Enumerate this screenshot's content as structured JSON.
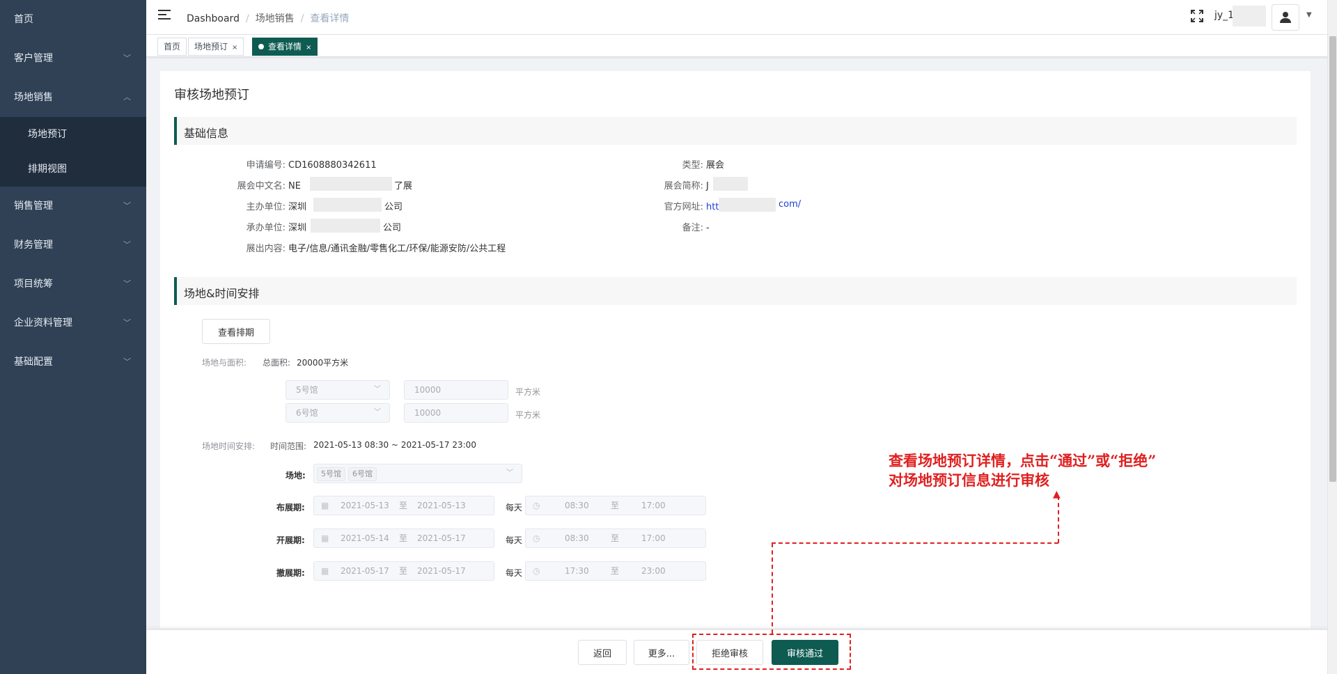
{
  "sidebar": {
    "items": [
      {
        "label": "首页"
      },
      {
        "label": "客户管理",
        "chevron": "down"
      },
      {
        "label": "场地销售",
        "chevron": "up",
        "children": [
          {
            "label": "场地预订"
          },
          {
            "label": "排期视图"
          }
        ]
      },
      {
        "label": "销售管理",
        "chevron": "down"
      },
      {
        "label": "财务管理",
        "chevron": "down"
      },
      {
        "label": "项目统筹",
        "chevron": "down"
      },
      {
        "label": "企业资料管理",
        "chevron": "down"
      },
      {
        "label": "基础配置",
        "chevron": "down"
      }
    ]
  },
  "header": {
    "breadcrumb": [
      "Dashboard",
      "场地销售",
      "查看详情"
    ],
    "separator": "/",
    "username": "jy_1"
  },
  "tags": [
    {
      "label": "首页",
      "active": false
    },
    {
      "label": "场地预订",
      "active": false,
      "close": "×"
    },
    {
      "label": "查看详情",
      "active": true,
      "close": "×"
    }
  ],
  "page": {
    "title": "审核场地预订",
    "basic": {
      "heading": "基础信息",
      "left": [
        {
          "label": "申请编号:",
          "value": "CD1608880342611"
        },
        {
          "label": "展会中文名:",
          "value": "NE",
          "suffix": "了展"
        },
        {
          "label": "主办单位:",
          "value": "深圳",
          "suffix": "公司"
        },
        {
          "label": "承办单位:",
          "value": "深圳",
          "suffix": "公司"
        },
        {
          "label": "展出内容:",
          "value": "电子/信息/通讯金融/零售化工/环保/能源安防/公共工程"
        }
      ],
      "right": [
        {
          "label": "类型:",
          "value": "展会"
        },
        {
          "label": "展会简称:",
          "value": "J"
        },
        {
          "label": "官方网址:",
          "value": "https://www",
          "suffix": "com/"
        },
        {
          "label": "备注:",
          "value": "-"
        }
      ]
    },
    "schedule": {
      "heading": "场地&时间安排",
      "view_button": "查看排期",
      "area_label": "场地与面积:",
      "total_area": "总面积:",
      "total_area_value": "20000平方米",
      "halls": [
        {
          "hall": "5号馆",
          "area": "10000",
          "unit": "平方米"
        },
        {
          "hall": "6号馆",
          "area": "10000",
          "unit": "平方米"
        }
      ],
      "time_label": "场地时间安排:",
      "time_range_label": "时间范围:",
      "time_range": "2021-05-13 08:30 ~ 2021-05-17 23:00",
      "venue_label": "场地:",
      "venue_chips": [
        "5号馆",
        "6号馆"
      ],
      "per_day": "每天",
      "to": "至",
      "phases": [
        {
          "label": "布展期:",
          "start": "2021-05-13",
          "end": "2021-05-13",
          "t_start": "08:30",
          "t_end": "17:00"
        },
        {
          "label": "开展期:",
          "start": "2021-05-14",
          "end": "2021-05-17",
          "t_start": "08:30",
          "t_end": "17:00"
        },
        {
          "label": "撤展期:",
          "start": "2021-05-17",
          "end": "2021-05-17",
          "t_start": "17:30",
          "t_end": "23:00"
        }
      ]
    }
  },
  "footer": {
    "back": "返回",
    "more": "更多...",
    "reject": "拒绝审核",
    "approve": "审核通过"
  },
  "annotation": {
    "line1": "查看场地预订详情，点击“通过”或“拒绝”",
    "line2": "对场地预订信息进行审核"
  },
  "colors": {
    "sidebar": "#304156",
    "accent": "#0e5b52",
    "annotation": "#e02020"
  }
}
